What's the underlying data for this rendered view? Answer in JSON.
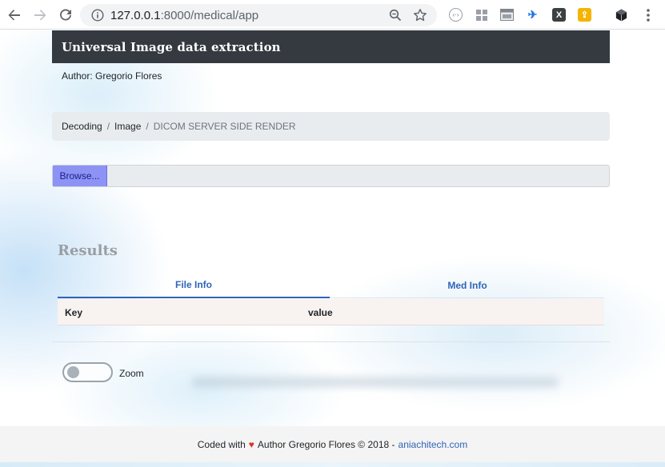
{
  "browser": {
    "url_host": "127.0.0.1",
    "url_rest": ":8000/medical/app",
    "extensions": [
      "translate-extension-icon",
      "grid-extension-icon",
      "window-extension-icon",
      "arrow-extension-icon",
      "x-extension-icon",
      "upload-extension-icon",
      "cube-extension-icon"
    ]
  },
  "header": {
    "title": "Universal Image data extraction"
  },
  "author_line": "Author: Gregorio Flores",
  "breadcrumb": {
    "items": [
      "Decoding",
      "Image"
    ],
    "separator": "/",
    "active": "DICOM SERVER SIDE RENDER"
  },
  "file_input": {
    "button_label": "Browse..."
  },
  "results": {
    "title": "Results",
    "tabs": [
      "File Info",
      "Med Info"
    ],
    "active_tab": "File Info",
    "columns": [
      "Key",
      "value"
    ]
  },
  "zoom": {
    "label": "Zoom",
    "enabled": false
  },
  "footer": {
    "prefix": "Coded with",
    "heart": "♥",
    "middle": "Author Gregorio Flores © 2018 -",
    "link": "aniachitech.com"
  },
  "colors": {
    "header_bg": "#343a40",
    "breadcrumb_bg": "#e9ecef",
    "browse_button": "#8c93f4",
    "tab_accent": "#2f64b8",
    "heart": "#d9342b"
  }
}
